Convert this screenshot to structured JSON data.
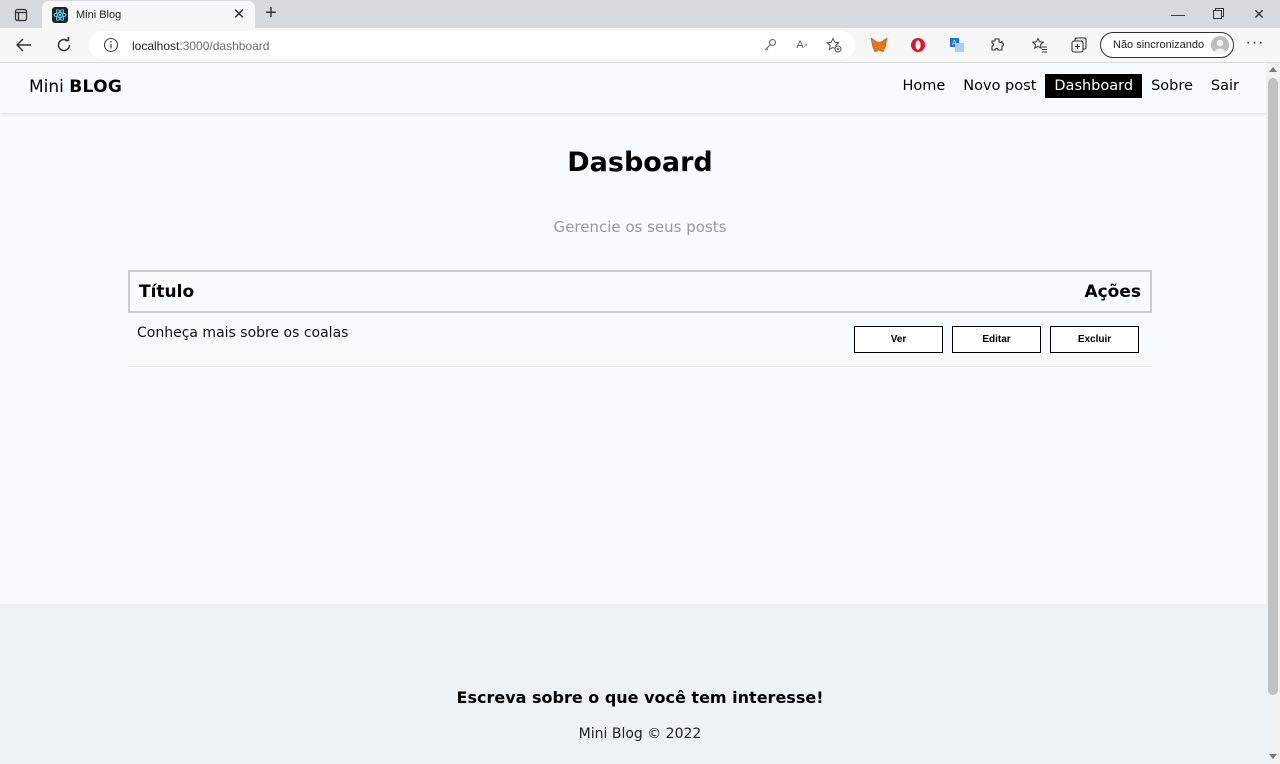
{
  "browser": {
    "tab": {
      "title": "Mini Blog",
      "favicon": "react-icon"
    },
    "address": {
      "host": "localhost",
      "path": ":3000/dashboard"
    },
    "sync_label": "Não sincronizando"
  },
  "navbar": {
    "brand_light": "Mini",
    "brand_bold": "BLOG",
    "links": [
      {
        "label": "Home"
      },
      {
        "label": "Novo post"
      },
      {
        "label": "Dashboard",
        "active": true
      },
      {
        "label": "Sobre"
      },
      {
        "label": "Sair"
      }
    ]
  },
  "dashboard": {
    "title": "Dasboard",
    "subtitle": "Gerencie os seus posts",
    "table": {
      "col_title": "Título",
      "col_actions": "Ações",
      "rows": [
        {
          "title": "Conheça mais sobre os coalas",
          "actions": [
            "Ver",
            "Editar",
            "Excluir"
          ]
        }
      ]
    }
  },
  "footer": {
    "slogan": "Escreva sobre o que você tem interesse!",
    "copyright": "Mini Blog © 2022"
  },
  "colors": {
    "page_bg": "#f7fbfe",
    "footer_bg": "#edf2f6",
    "active_nav_bg": "#000000",
    "subtitle": "#9a9a9a"
  }
}
